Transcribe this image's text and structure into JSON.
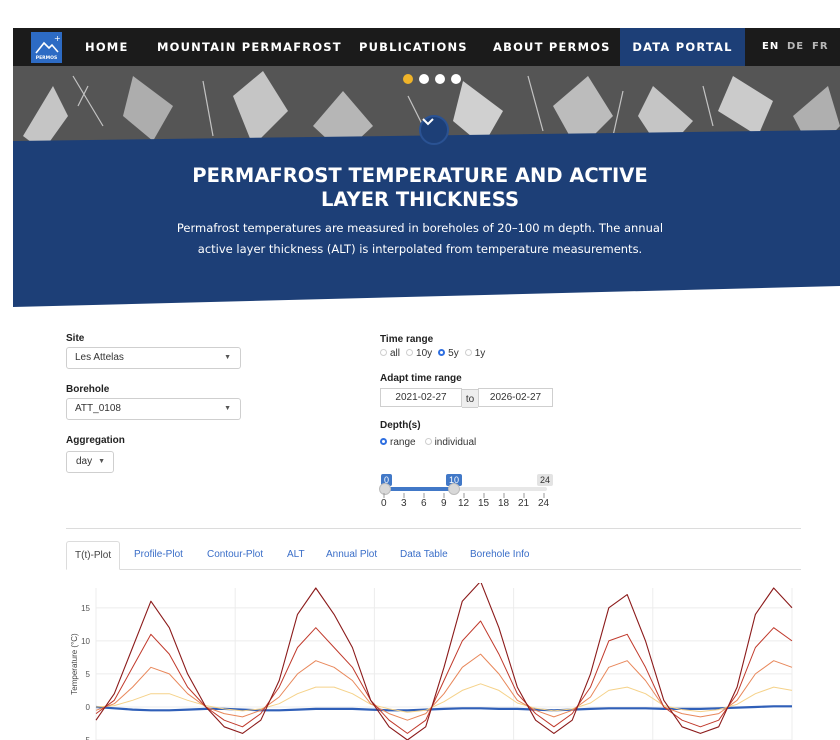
{
  "nav": {
    "logo_text": "PERMOS",
    "items": [
      "HOME",
      "MOUNTAIN PERMAFROST",
      "PUBLICATIONS",
      "ABOUT PERMOS",
      "DATA PORTAL"
    ],
    "active": "DATA PORTAL",
    "languages": [
      "EN",
      "DE",
      "FR"
    ]
  },
  "carousel": {
    "dot_count": 4,
    "active_index": 0
  },
  "banner": {
    "title_line1": "PERMAFROST TEMPERATURE AND ACTIVE",
    "title_line2": "LAYER THICKNESS",
    "subtitle_line1": "Permafrost temperatures are measured in boreholes of 20–100 m depth. The annual",
    "subtitle_line2": "active layer thickness (ALT) is interpolated from temperature measurements."
  },
  "form": {
    "site_label": "Site",
    "site_value": "Les Attelas",
    "borehole_label": "Borehole",
    "borehole_value": "ATT_0108",
    "aggregation_label": "Aggregation",
    "aggregation_value": "day",
    "time_range_label": "Time range",
    "time_range_options": [
      "all",
      "10y",
      "5y",
      "1y"
    ],
    "time_range_selected": "5y",
    "adapt_label": "Adapt time range",
    "date_from": "2021-02-27",
    "date_to_word": "to",
    "date_to": "2026-02-27",
    "depth_label": "Depth(s)",
    "depth_options": [
      "range",
      "individual"
    ],
    "depth_selected": "range",
    "slider": {
      "min_badge": "0",
      "max_badge": "10",
      "end_badge": "24",
      "min": 0,
      "max": 24,
      "low": 0,
      "high": 10,
      "ticks": [
        "0",
        "3",
        "6",
        "9",
        "12",
        "15",
        "18",
        "21",
        "24"
      ]
    }
  },
  "tabs": [
    "T(t)-Plot",
    "Profile-Plot",
    "Contour-Plot",
    "ALT",
    "Annual Plot",
    "Data Table",
    "Borehole Info"
  ],
  "active_tab": "T(t)-Plot",
  "colors": {
    "nav_bg": "#1b1b1b",
    "banner_blue": "#1d3f77",
    "accent_gold": "#f0b429",
    "link_blue": "#3a6ec8"
  },
  "chart_data": {
    "type": "line",
    "ylabel": "Temperature (°C)",
    "yticks": [
      "15",
      "10",
      "5",
      "0",
      "-5"
    ],
    "ylim": [
      -5,
      18
    ],
    "grid": true,
    "x_range": [
      "2021-02-27",
      "2026-02-27"
    ],
    "series": [
      {
        "values": [
          -2,
          2,
          9,
          16,
          12,
          5,
          0,
          -3,
          -4,
          -2,
          4,
          14,
          18,
          14,
          9,
          1,
          -3,
          -5,
          -3,
          6,
          16,
          19,
          12,
          3,
          -2,
          -4,
          -2,
          5,
          15,
          17,
          10,
          1,
          -3,
          -4,
          -3,
          3,
          14,
          18,
          15
        ]
      },
      {
        "values": [
          -1,
          1,
          6,
          11,
          8,
          3,
          0,
          -2,
          -3,
          -1,
          3,
          9,
          12,
          9,
          6,
          1,
          -2,
          -4,
          -2,
          4,
          10,
          13,
          8,
          2,
          -1,
          -3,
          -1,
          3,
          10,
          11,
          6,
          0,
          -2,
          -3,
          -2,
          2,
          9,
          12,
          10
        ]
      },
      {
        "values": [
          -0.5,
          0.5,
          3,
          6,
          5,
          2,
          0,
          -1,
          -1.5,
          -0.5,
          1.5,
          5,
          7,
          6,
          4,
          0.5,
          -1,
          -2,
          -1,
          2,
          6,
          8,
          5,
          1,
          -0.5,
          -1.5,
          -0.5,
          1.5,
          6,
          7,
          4,
          0,
          -1,
          -1.5,
          -1,
          1,
          5,
          7,
          6
        ]
      },
      {
        "values": [
          0,
          0.2,
          1,
          2,
          2,
          1,
          0.2,
          -0.3,
          -0.6,
          -0.3,
          0.5,
          2,
          3,
          3,
          2,
          0.4,
          -0.3,
          -0.8,
          -0.5,
          0.8,
          2.5,
          3.5,
          2.5,
          0.6,
          -0.2,
          -0.6,
          -0.3,
          0.6,
          2.5,
          3,
          2,
          0.2,
          -0.4,
          -0.7,
          -0.4,
          0.4,
          2,
          3,
          2.5
        ]
      },
      {
        "values": [
          0,
          -0.2,
          -0.4,
          -0.5,
          -0.5,
          -0.4,
          -0.3,
          -0.3,
          -0.4,
          -0.5,
          -0.5,
          -0.4,
          -0.3,
          -0.3,
          -0.3,
          -0.4,
          -0.5,
          -0.5,
          -0.4,
          -0.3,
          -0.2,
          -0.2,
          -0.3,
          -0.3,
          -0.4,
          -0.5,
          -0.4,
          -0.3,
          -0.2,
          -0.2,
          -0.2,
          -0.3,
          -0.3,
          -0.3,
          -0.2,
          -0.1,
          0,
          0.1,
          0.1
        ]
      }
    ]
  }
}
